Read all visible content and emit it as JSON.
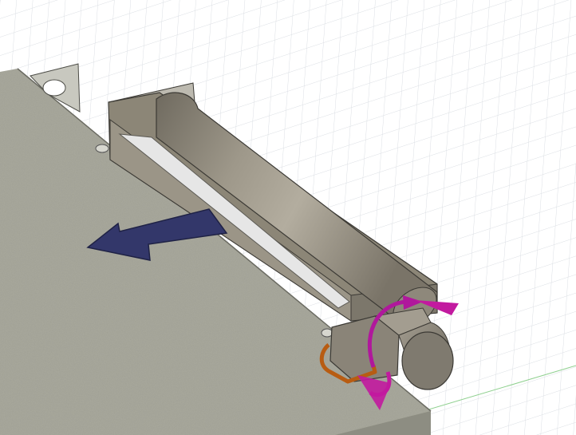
{
  "viewport": {
    "view_type": "3D modeling viewport",
    "background_color": "#ffffff",
    "grid_color": "#d9dde2",
    "axis_color": "#8fd08f"
  },
  "model": {
    "plate_color": "#a8a89c",
    "housing_color": "#8c8677",
    "cylinder_color": "#9a9385",
    "slot_color": "#e6e6e6",
    "motor_color": "#8a8478",
    "motor_end_color": "#7f7a6f"
  },
  "gizmos": {
    "translate_arrow": {
      "icon": "arrow-left-icon",
      "color": "#33376a"
    },
    "rotate_arrow_primary": {
      "icon": "rotate-arrow-icon",
      "color": "#b0189c"
    },
    "rotate_arrow_secondary": {
      "icon": "rotate-arrow-icon",
      "color": "#c21a9f"
    },
    "bracket_handle": {
      "icon": "bracket-icon",
      "color": "#b85c12"
    }
  }
}
